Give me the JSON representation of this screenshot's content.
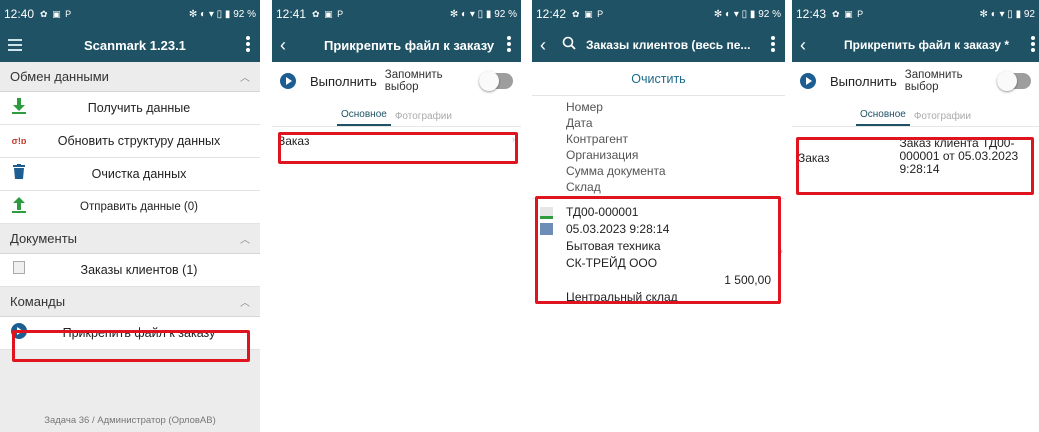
{
  "status": {
    "p1_time": "12:40",
    "p2_time": "12:41",
    "p3_time": "12:42",
    "p4_time": "12:43",
    "icons": "✿ ▣ P",
    "right_p1": "✻ ◐ ▾ ▯ ▮ 92 %",
    "right_p2": "✻ ◐ ▾ ▯ ▮ 92 %",
    "right_p3": "✻ ◐ ▾ ▯ ▮ 92 %",
    "right_p4": "✻ ◐ ▾ ▯ ▮ 92"
  },
  "screen1": {
    "title": "Scanmark 1.23.1",
    "sections": {
      "data_exchange": "Обмен данными",
      "documents": "Документы",
      "commands": "Команды"
    },
    "items": {
      "get_data": "Получить данные",
      "update_structure": "Обновить структуру данных",
      "clear_data": "Очистка данных",
      "send_data": "Отправить данные (0)",
      "customer_orders": "Заказы клиентов (1)",
      "attach_file": "Прикрепить файл к заказу"
    },
    "footer": "Задача 36 / Администратор (ОрловАВ)"
  },
  "screen2": {
    "title": "Прикрепить файл к заказу",
    "run": "Выполнить",
    "remember": "Запомнить выбор",
    "tab_main": "Основное",
    "tab_photos": "Фотографии",
    "order_label": "Заказ"
  },
  "screen3": {
    "title": "Заказы клиентов (весь пе...",
    "clear": "Очистить",
    "header_fields": [
      "Номер",
      "Дата",
      "Контрагент",
      "Организация",
      "Сумма документа",
      "Склад"
    ],
    "order": {
      "number": "ТД00-000001",
      "date": "05.03.2023 9:28:14",
      "counterparty": "Бытовая техника",
      "organization": "СК-ТРЕЙД ООО",
      "amount": "1 500,00",
      "warehouse": "Центральный склад"
    }
  },
  "screen4": {
    "title": "Прикрепить файл к заказу *",
    "run": "Выполнить",
    "remember": "Запомнить выбор",
    "tab_main": "Основное",
    "tab_photos": "Фотографии",
    "order_label": "Заказ",
    "order_value": "Заказ клиента ТД00-000001 от 05.03.2023 9:28:14"
  },
  "colors": {
    "appbar": "#1f5264",
    "highlight": "#e0141e",
    "accent_icon": "#1d5e92",
    "green_icon": "#2e9b3e"
  },
  "icons": {
    "menu": "hamburger-icon",
    "overflow": "more-vert-icon",
    "back": "arrow-back-icon",
    "search": "search-icon",
    "download": "download-icon",
    "sync": "sync-icon",
    "trash": "trash-icon",
    "upload": "upload-icon",
    "run": "play-circle-icon"
  }
}
